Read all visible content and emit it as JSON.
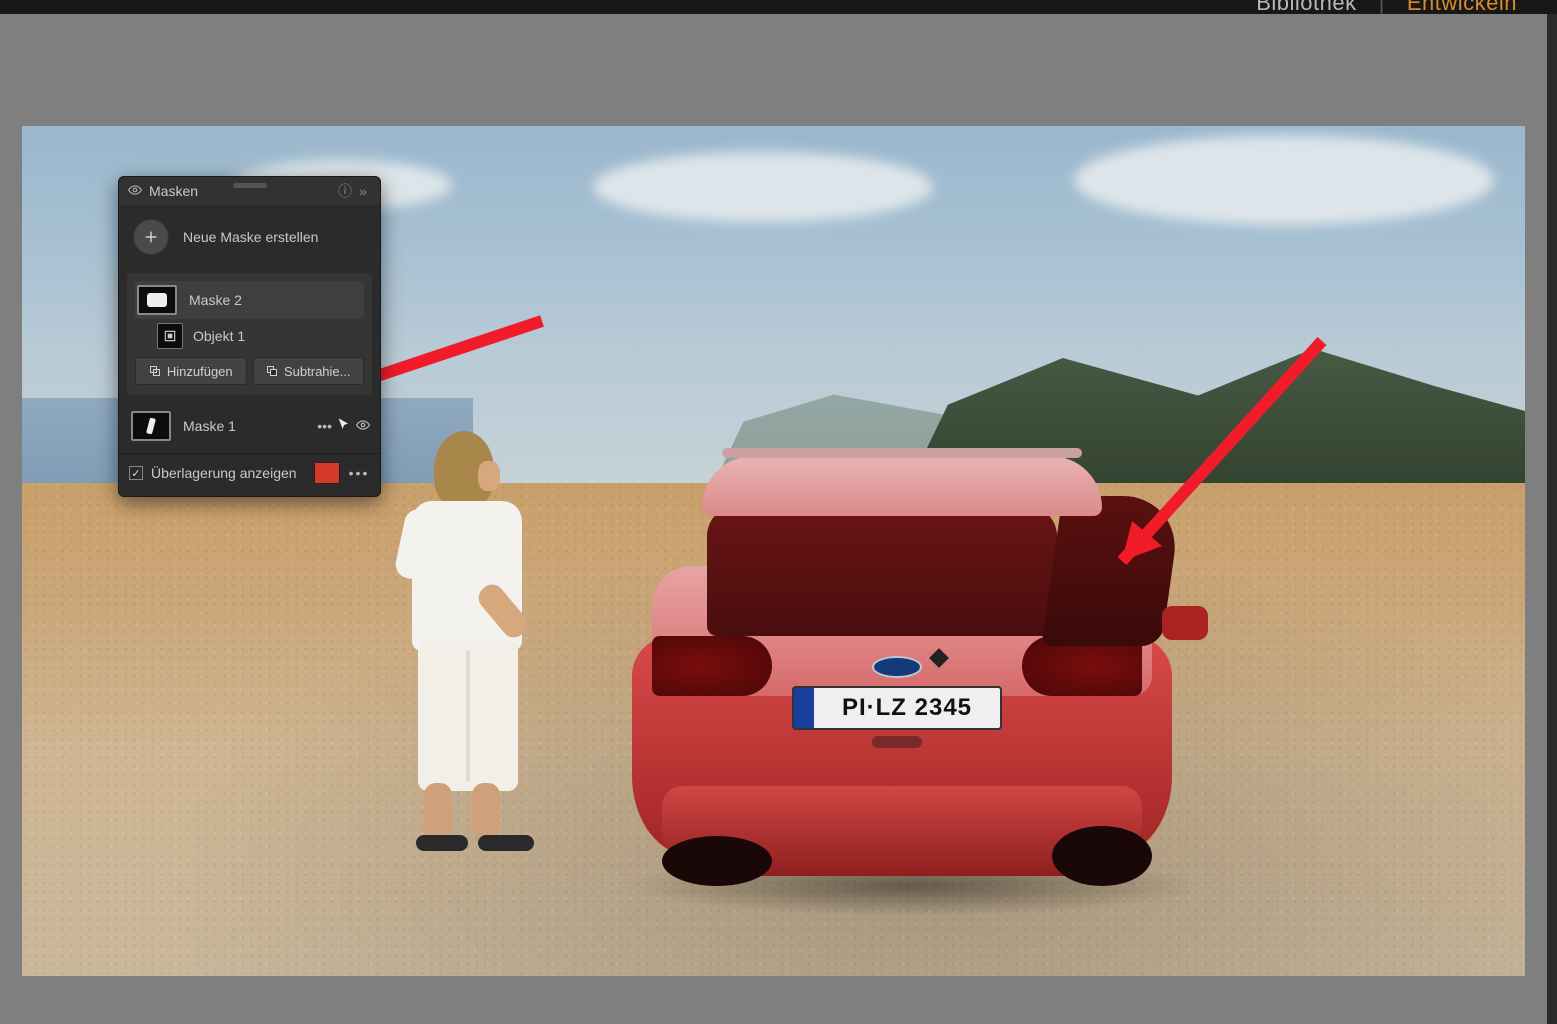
{
  "modules": {
    "library": "Bibliothek",
    "develop": "Entwickeln"
  },
  "panel": {
    "title": "Masken",
    "create_label": "Neue Maske erstellen",
    "mask2": {
      "name": "Maske 2",
      "object": "Objekt 1",
      "add": "Hinzufügen",
      "subtract": "Subtrahie..."
    },
    "mask1": {
      "name": "Maske 1"
    },
    "overlay_label": "Überlagerung anzeigen",
    "overlay_checked": "✓",
    "overlay_color": "#d83a2a"
  },
  "plate": "PI·LZ 2345",
  "icons": {
    "eye": "eye-icon",
    "help": "help-icon",
    "expand": "expand-icon",
    "plus": "plus-icon",
    "object": "object-icon",
    "more": "more-icon",
    "cursor": "cursor-icon"
  }
}
